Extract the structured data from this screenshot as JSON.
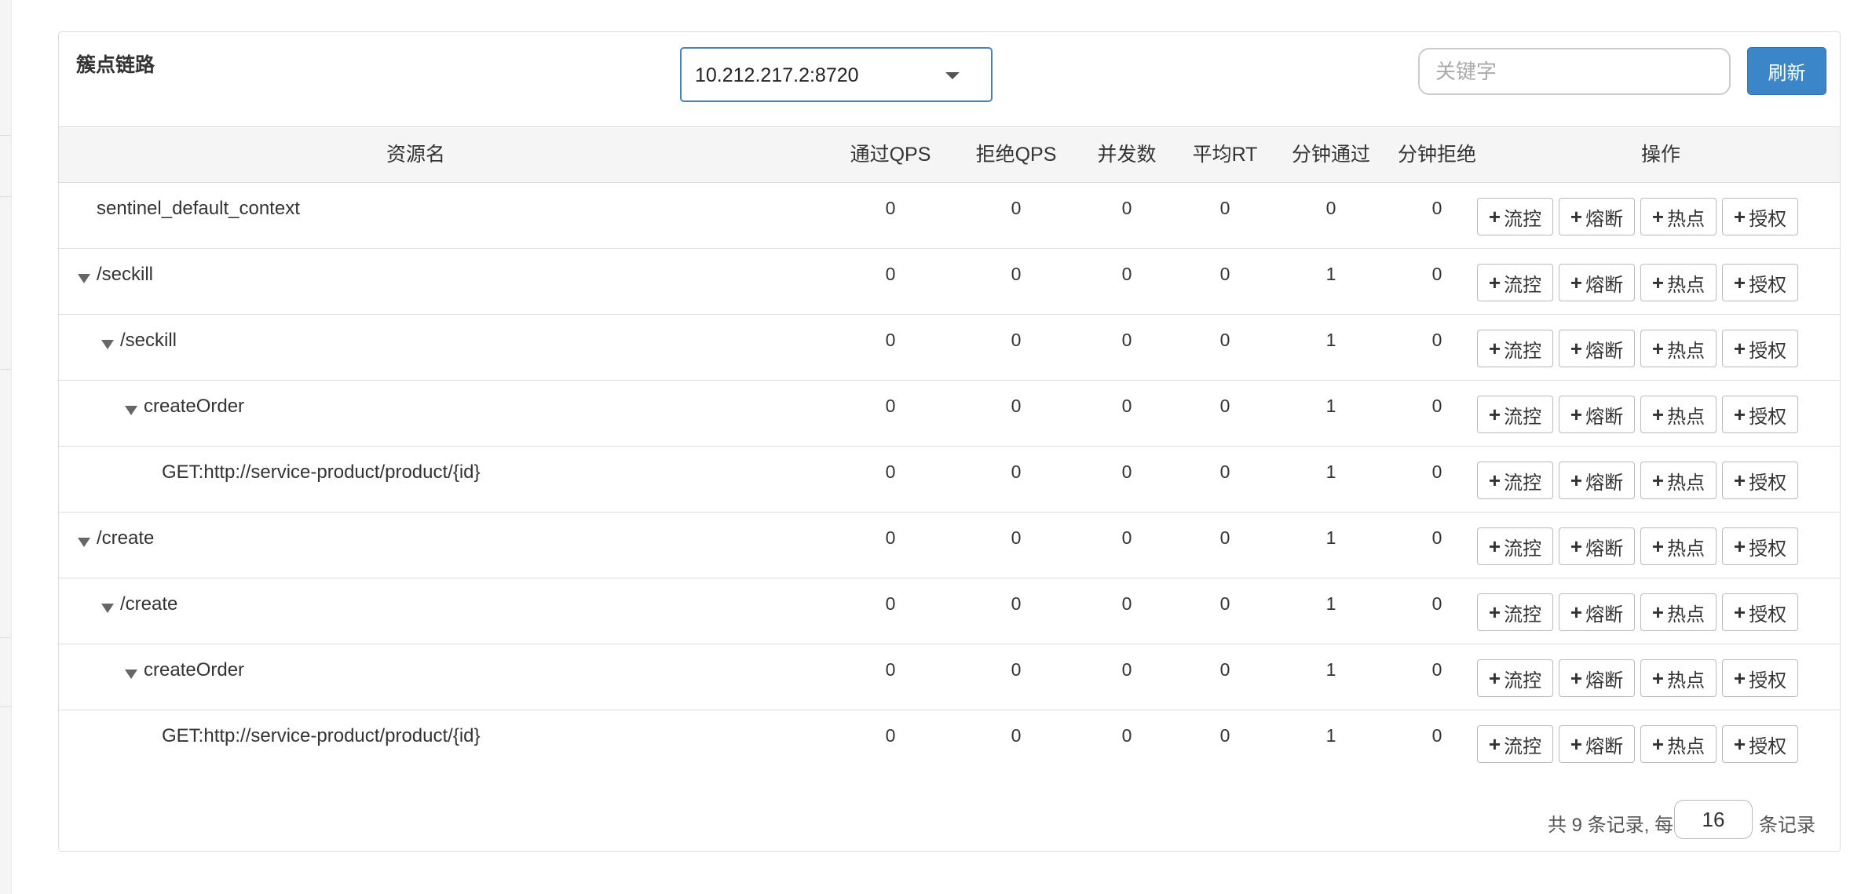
{
  "panel": {
    "title": "簇点链路"
  },
  "machine_select": {
    "value": "10.212.217.2:8720"
  },
  "search": {
    "placeholder": "关键字"
  },
  "refresh_label": "刷新",
  "columns": [
    "资源名",
    "通过QPS",
    "拒绝QPS",
    "并发数",
    "平均RT",
    "分钟通过",
    "分钟拒绝",
    "操作"
  ],
  "rows": [
    {
      "name": "sentinel_default_context",
      "level": 0,
      "expandable": false,
      "pass_qps": "0",
      "block_qps": "0",
      "threads": "0",
      "avg_rt": "0",
      "minute_pass": "0",
      "minute_block": "0"
    },
    {
      "name": "/seckill",
      "level": 0,
      "expandable": true,
      "pass_qps": "0",
      "block_qps": "0",
      "threads": "0",
      "avg_rt": "0",
      "minute_pass": "1",
      "minute_block": "0"
    },
    {
      "name": "/seckill",
      "level": 1,
      "expandable": true,
      "pass_qps": "0",
      "block_qps": "0",
      "threads": "0",
      "avg_rt": "0",
      "minute_pass": "1",
      "minute_block": "0"
    },
    {
      "name": "createOrder",
      "level": 2,
      "expandable": true,
      "pass_qps": "0",
      "block_qps": "0",
      "threads": "0",
      "avg_rt": "0",
      "minute_pass": "1",
      "minute_block": "0"
    },
    {
      "name": "GET:http://service-product/product/{id}",
      "level": 3,
      "expandable": false,
      "pass_qps": "0",
      "block_qps": "0",
      "threads": "0",
      "avg_rt": "0",
      "minute_pass": "1",
      "minute_block": "0"
    },
    {
      "name": "/create",
      "level": 0,
      "expandable": true,
      "pass_qps": "0",
      "block_qps": "0",
      "threads": "0",
      "avg_rt": "0",
      "minute_pass": "1",
      "minute_block": "0"
    },
    {
      "name": "/create",
      "level": 1,
      "expandable": true,
      "pass_qps": "0",
      "block_qps": "0",
      "threads": "0",
      "avg_rt": "0",
      "minute_pass": "1",
      "minute_block": "0"
    },
    {
      "name": "createOrder",
      "level": 2,
      "expandable": true,
      "pass_qps": "0",
      "block_qps": "0",
      "threads": "0",
      "avg_rt": "0",
      "minute_pass": "1",
      "minute_block": "0"
    },
    {
      "name": "GET:http://service-product/product/{id}",
      "level": 3,
      "expandable": false,
      "pass_qps": "0",
      "block_qps": "0",
      "threads": "0",
      "avg_rt": "0",
      "minute_pass": "1",
      "minute_block": "0"
    }
  ],
  "actions": [
    {
      "key": "flow",
      "label": "流控"
    },
    {
      "key": "degrade",
      "label": "熔断"
    },
    {
      "key": "hotspot",
      "label": "热点"
    },
    {
      "key": "authority",
      "label": "授权"
    }
  ],
  "pagination": {
    "prefix": "共 9 条记录, 每页",
    "page_size": "16",
    "suffix": "条记录"
  }
}
